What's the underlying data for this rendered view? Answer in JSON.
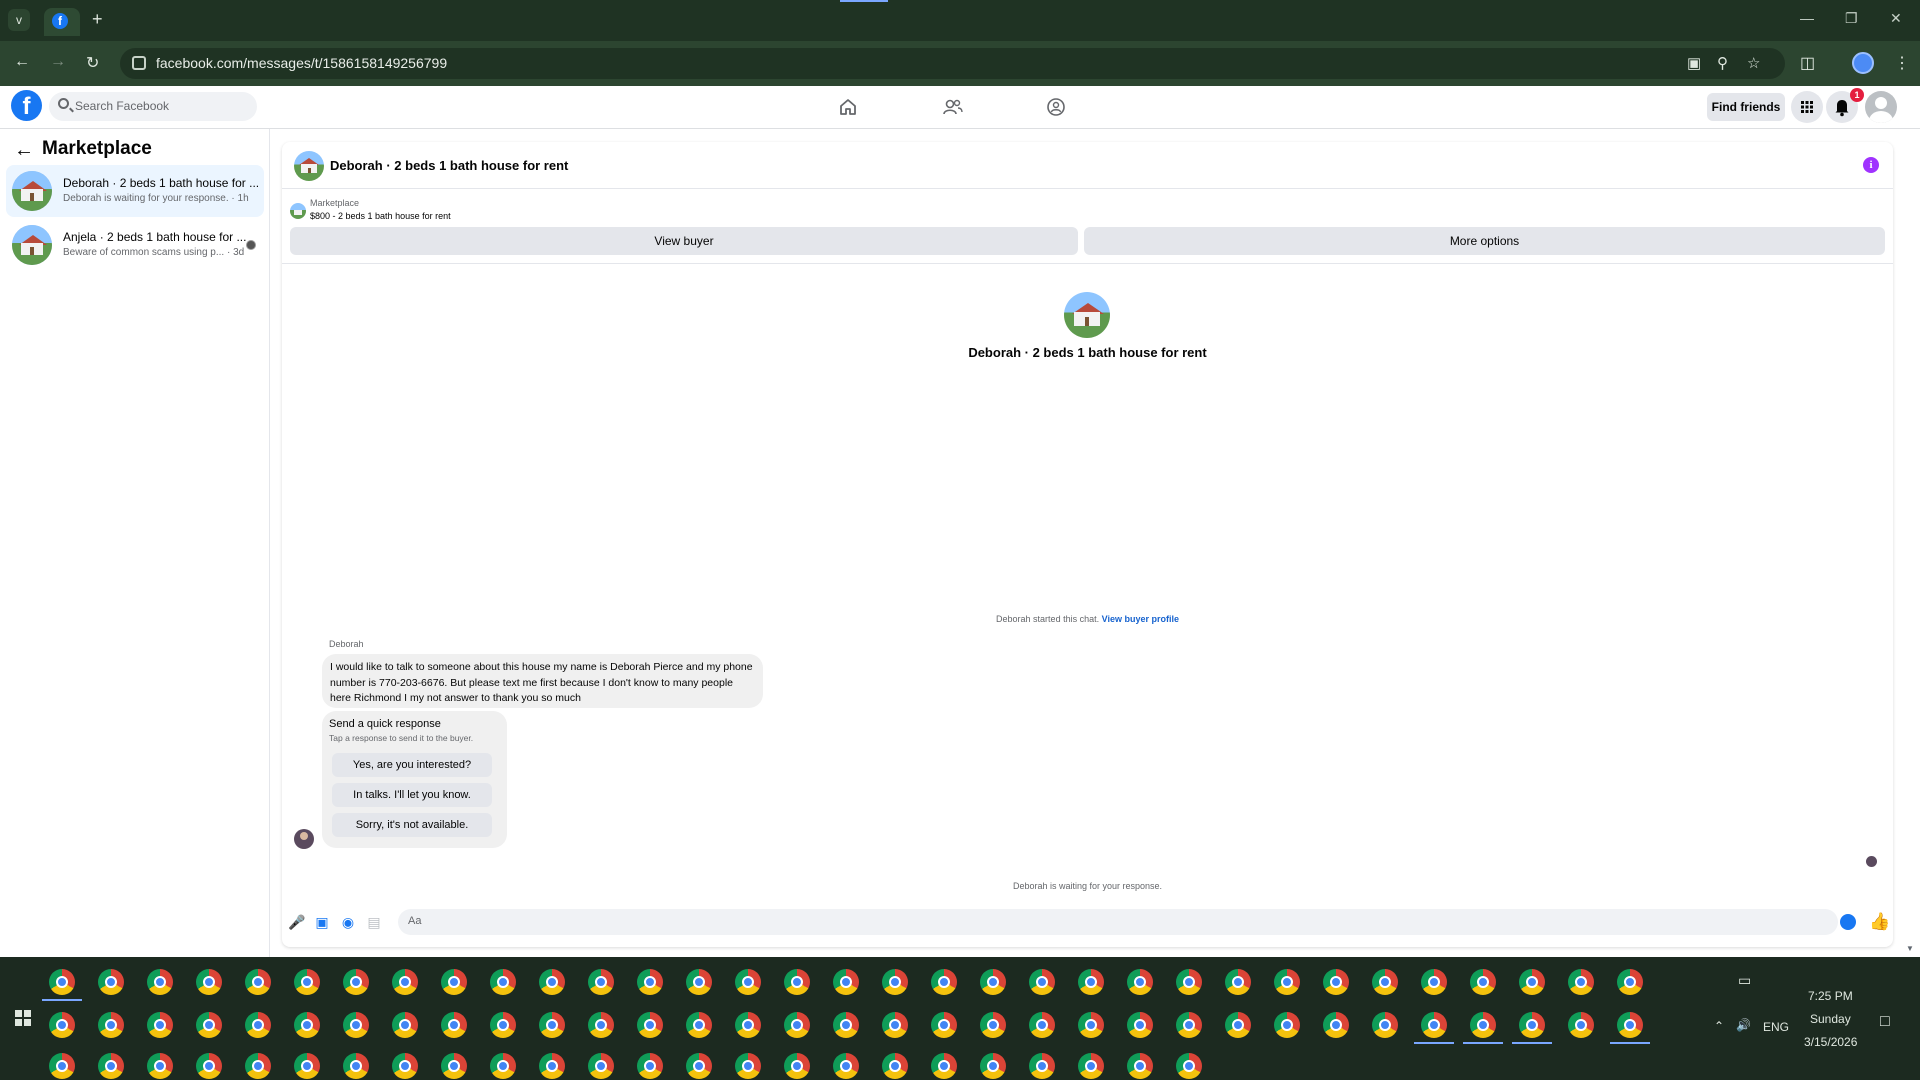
{
  "browser": {
    "url": "facebook.com/messages/t/1586158149256799",
    "new_tab_glyph": "+",
    "menu_glyph": "v"
  },
  "fb": {
    "logo_letter": "f",
    "search_placeholder": "Search Facebook",
    "find_friends": "Find friends",
    "notification_count": "1"
  },
  "sidebar": {
    "title": "Marketplace",
    "conversations": [
      {
        "name": "Deborah · 2 beds 1 bath house for ...",
        "snippet": "Deborah is waiting for your response. · 1h"
      },
      {
        "name": "Anjela · 2 beds 1 bath house for ...",
        "snippet": "Beware of common scams using p... · 3d"
      }
    ]
  },
  "chat": {
    "title": "Deborah · 2 beds 1 bath house for rent",
    "listing_source": "Marketplace",
    "listing_price": "$800 - 2 beds 1 bath house for rent",
    "view_buyer": "View buyer",
    "more_options": "More options",
    "started_text": "Deborah started this chat.",
    "view_buyer_profile": "View buyer profile",
    "sender": "Deborah",
    "message": "I would like to talk to someone about this house my name is Deborah Pierce and my phone number is 770-203-6676. But please text me first because I don't know to many people here Richmond I my not answer to thank you so much",
    "quick_title": "Send a quick response",
    "quick_subtitle": "Tap a response to send it to the buyer.",
    "quick_replies": [
      "Yes, are you interested?",
      "In talks. I'll let you know.",
      "Sorry, it's not available."
    ],
    "waiting": "Deborah is waiting for your response.",
    "composer_placeholder": "Aa"
  },
  "tray": {
    "time": "7:25 PM",
    "day": "Sunday",
    "date": "3/15/2026",
    "lang": "ENG"
  },
  "colors": {
    "fb_blue": "#1877f2",
    "browser_frame": "#1f3323",
    "taskbar": "#1c2a20"
  }
}
